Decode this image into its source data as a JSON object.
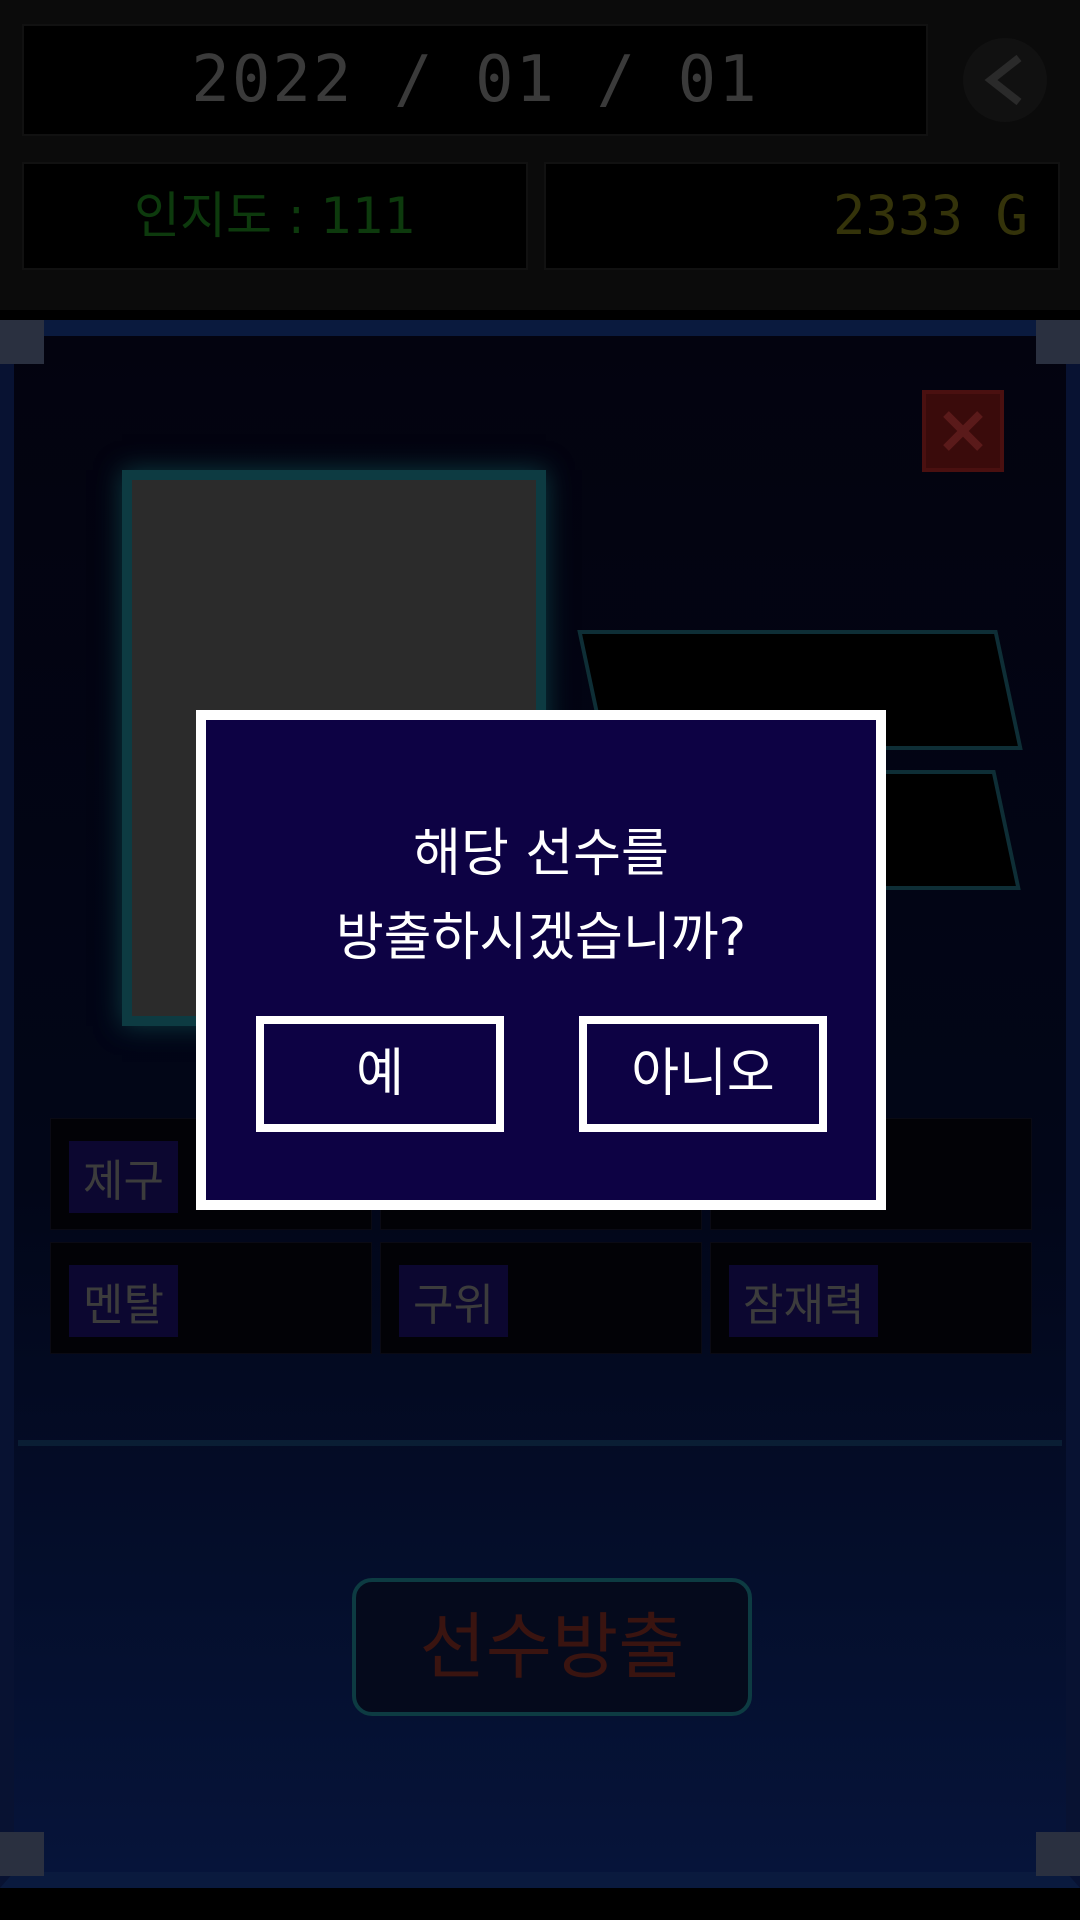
{
  "header": {
    "date": "2022 / 01 / 01",
    "fame": "인지도 : 111",
    "gold": "2333 G"
  },
  "stats": {
    "tags": [
      "제구",
      "",
      "",
      "멘탈",
      "구위",
      "잠재력"
    ]
  },
  "release_button_label": "선수방출",
  "dialog": {
    "line1": "해당 선수를",
    "line2": "방출하시겠습니까?",
    "yes_label": "예",
    "no_label": "아니오"
  },
  "icons": {
    "back": "chevron-left-icon",
    "close": "close-icon"
  },
  "colors": {
    "dialog_bg": "#0d0244",
    "dialog_border": "#ffffff",
    "fame_text": "#0d3a0d",
    "gold_text": "#34330a"
  }
}
